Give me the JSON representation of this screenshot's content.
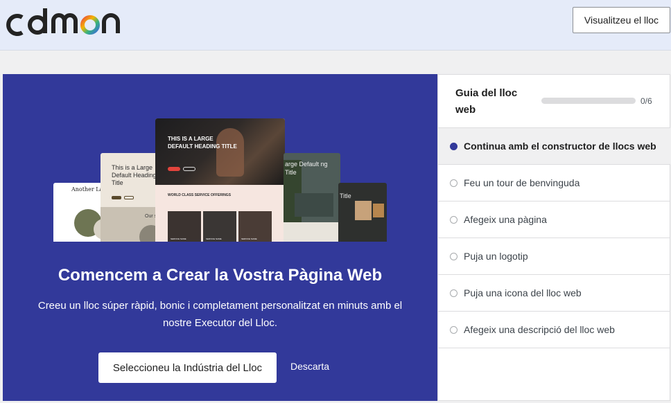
{
  "header": {
    "logo_text": "cdmon",
    "view_site_label": "Visualitzeu el lloc"
  },
  "hero": {
    "title": "Comencem a Crear la Vostra Pàgina Web",
    "description": "Creeu un lloc súper ràpid, bonic i completament personalitzat en minuts amb el nostre Executor del Lloc.",
    "primary_button": "Seleccioneu la Indústria del Lloc",
    "dismiss_label": "Descarta",
    "background_color": "#32399a",
    "previews": {
      "a_heading": "Another La Headi",
      "b_heading": "This is a Large Default Heading Title",
      "b_sub": "Our se",
      "c_heading": "THIS IS A LARGE DEFAULT HEADING TITLE",
      "c_section": "WORLD CLASS SERVICE OFFERINGS",
      "c_cards": [
        "SERVICE NAME",
        "SERVICE NAME",
        "SERVICE NAME"
      ],
      "d_heading": "arge Default ng Title",
      "e_heading": "Title"
    }
  },
  "guide": {
    "title": "Guia del lloc web",
    "progress_text": "0/6",
    "progress_fraction": 0,
    "steps": [
      {
        "label": "Continua amb el constructor de llocs web",
        "active": true
      },
      {
        "label": "Feu un tour de benvinguda",
        "active": false
      },
      {
        "label": "Afegeix una pàgina",
        "active": false
      },
      {
        "label": "Puja un logotip",
        "active": false
      },
      {
        "label": "Puja una icona del lloc web",
        "active": false
      },
      {
        "label": "Afegeix una descripció del lloc web",
        "active": false
      }
    ]
  }
}
